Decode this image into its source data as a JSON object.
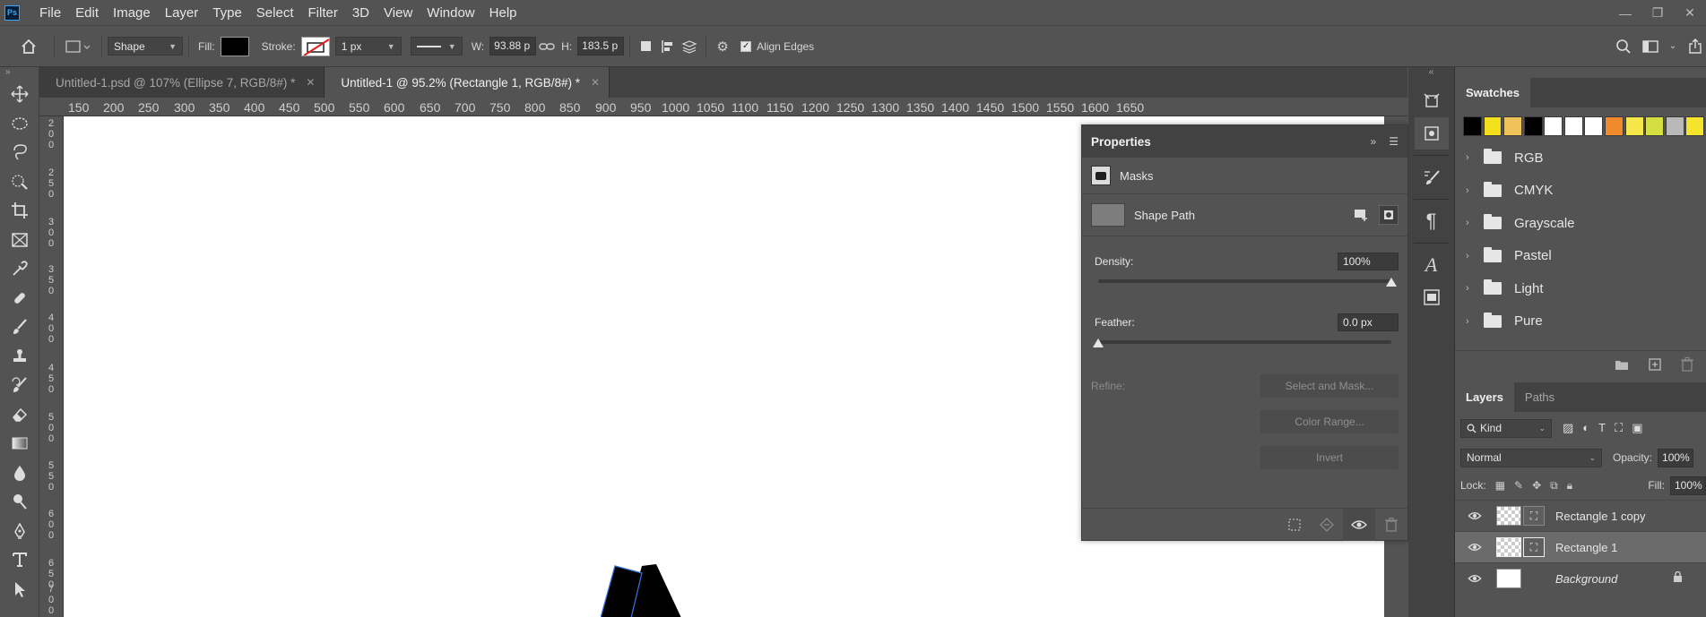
{
  "app": {
    "logo": "Ps"
  },
  "menu": [
    "File",
    "Edit",
    "Image",
    "Layer",
    "Type",
    "Select",
    "Filter",
    "3D",
    "View",
    "Window",
    "Help"
  ],
  "window_controls": {
    "minimize": "—",
    "restore": "❐",
    "close": "✕"
  },
  "options": {
    "mode": "Shape",
    "fill_label": "Fill:",
    "fill_color": "#000000",
    "stroke_label": "Stroke:",
    "stroke_width": "1 px",
    "w_label": "W:",
    "w_value": "93.88 p",
    "h_label": "H:",
    "h_value": "183.5 p",
    "align_edges": "Align Edges"
  },
  "toolbar": {
    "collapse": "»"
  },
  "tabs": [
    {
      "label": "Untitled-1.psd @ 107% (Ellipse 7, RGB/8#) *",
      "active": false
    },
    {
      "label": "Untitled-1 @ 95.2% (Rectangle 1, RGB/8#) *",
      "active": true
    }
  ],
  "ruler": {
    "top": [
      "150",
      "200",
      "250",
      "300",
      "350",
      "400",
      "450",
      "500",
      "550",
      "600",
      "650",
      "700",
      "750",
      "800",
      "850",
      "900",
      "950",
      "1000",
      "1050",
      "1100",
      "1150",
      "1200",
      "1250",
      "1300",
      "1350",
      "1400",
      "1450",
      "1500",
      "1550",
      "1600",
      "1650"
    ],
    "left": [
      "200",
      "250",
      "300",
      "350",
      "400",
      "450",
      "500",
      "550",
      "600",
      "650",
      "700"
    ]
  },
  "properties": {
    "title": "Properties",
    "section": "Masks",
    "shape_path": "Shape Path",
    "density_label": "Density:",
    "density_value": "100%",
    "density_level": 1.0,
    "feather_label": "Feather:",
    "feather_value": "0.0 px",
    "feather_level": 0.0,
    "refine_label": "Refine:",
    "select_and_mask": "Select and Mask...",
    "color_range": "Color Range...",
    "invert": "Invert"
  },
  "swatches": {
    "tab": "Swatches",
    "colors": [
      "#000000",
      "#f3e01a",
      "#f0c35a",
      "#000000",
      "#ffffff",
      "#ffffff",
      "#ffffff",
      "#f08a2a",
      "#f5e64a",
      "#d4e041",
      "#b9b9b9",
      "#f4e52c"
    ],
    "folders": [
      "RGB",
      "CMYK",
      "Grayscale",
      "Pastel",
      "Light",
      "Pure"
    ]
  },
  "layers": {
    "tab_layers": "Layers",
    "tab_paths": "Paths",
    "filter": "Kind",
    "blend_mode": "Normal",
    "opacity_label": "Opacity:",
    "opacity_value": "100%",
    "lock_label": "Lock:",
    "fill_label": "Fill:",
    "fill_value": "100%",
    "items": [
      {
        "name": "Rectangle 1 copy",
        "selected": false
      },
      {
        "name": "Rectangle 1",
        "selected": true
      },
      {
        "name": "Background",
        "selected": false
      }
    ]
  }
}
